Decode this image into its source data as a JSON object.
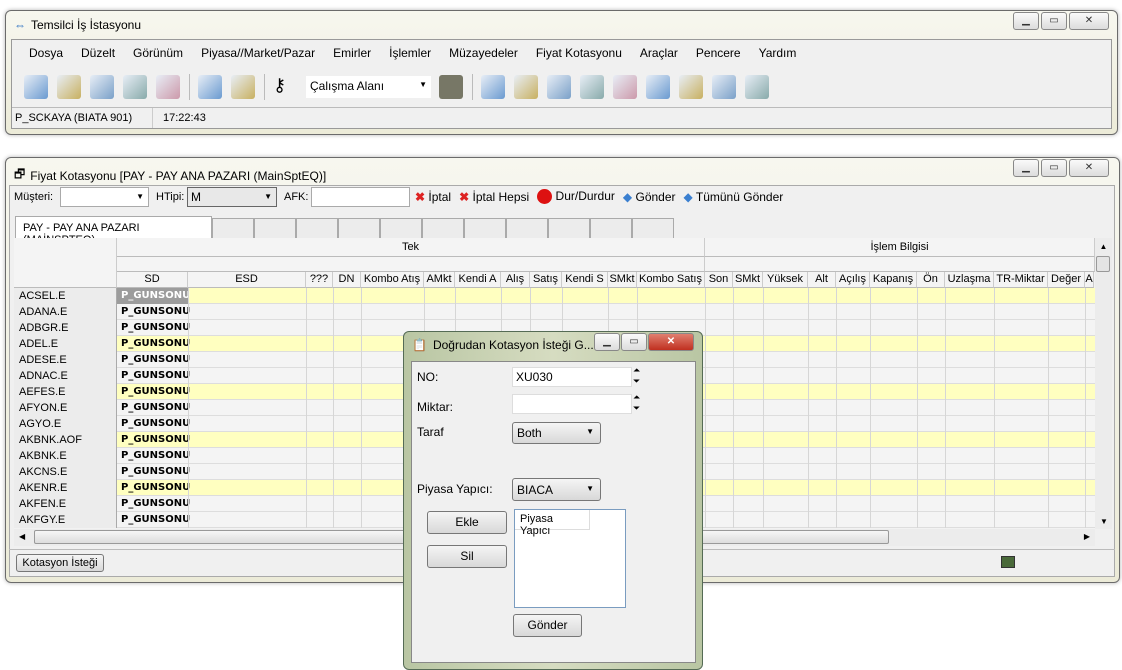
{
  "main_window": {
    "title": "Temsilci İş İstasyonu",
    "menu": [
      "Dosya",
      "Düzelt",
      "Görünüm",
      "Piyasa//Market/Pazar",
      "Emirler",
      "İşlemler",
      "Müzayedeler",
      "Fiyat Kotasyonu",
      "Araçlar",
      "Pencere",
      "Yardım"
    ],
    "toolbar_icons_a": [
      "search-icon",
      "info-icon",
      "download-icon",
      "document-arrow-icon",
      "new-window-icon"
    ],
    "toolbar_icons_b": [
      "add-window-icon",
      "layout-icon"
    ],
    "workspace_label": "Çalışma Alanı",
    "toolbar_icons_c": [
      "chat-icon",
      "heart-icon",
      "users-icon",
      "add-doc-icon",
      "star-doc-icon",
      "delete-doc-icon",
      "book-icon",
      "clock-icon",
      "doc-info-icon"
    ],
    "status_user": "P_SCKAYA (BIATA 901)",
    "status_time": "17:22:43"
  },
  "quote_window": {
    "title": "Fiyat Kotasyonu [PAY - PAY ANA PAZARI (MainSptEQ)]",
    "customer_label": "Müşteri:",
    "customer_value": "",
    "htipi_label": "HTipi:",
    "htipi_value": "M",
    "afk_label": "AFK:",
    "afk_value": "",
    "actions": {
      "cancel": "İptal",
      "cancel_all": "İptal Hepsi",
      "stop": "Dur/Durdur",
      "send": "Gönder",
      "send_all": "Tümünü Gönder"
    },
    "tab": "PAY - PAY ANA PAZARI (MAİNSPTEQ)",
    "group_headers": {
      "tek": "Tek",
      "islem": "İşlem Bilgisi"
    },
    "columns": [
      "SD",
      "ESD",
      "???",
      "DN",
      "Kombo Atış",
      "AMkt",
      "Kendi A",
      "Alış",
      "Satış",
      "Kendi S",
      "SMkt",
      "Kombo Satış",
      "Son",
      "SMkt",
      "Yüksek",
      "Alt",
      "Açılış",
      "Kapanış",
      "Ön",
      "Uzlaşma",
      "TR-Miktar",
      "Değer",
      "A"
    ],
    "rows": [
      [
        "ACSEL.E",
        "P_GUNSONU"
      ],
      [
        "ADANA.E",
        "P_GUNSONU"
      ],
      [
        "ADBGR.E",
        "P_GUNSONU"
      ],
      [
        "ADEL.E",
        "P_GUNSONU"
      ],
      [
        "ADESE.E",
        "P_GUNSONU"
      ],
      [
        "ADNAC.E",
        "P_GUNSONU"
      ],
      [
        "AEFES.E",
        "P_GUNSONU"
      ],
      [
        "AFYON.E",
        "P_GUNSONU"
      ],
      [
        "AGYO.E",
        "P_GUNSONU"
      ],
      [
        "AKBNK.AOF",
        "P_GUNSONU"
      ],
      [
        "AKBNK.E",
        "P_GUNSONU"
      ],
      [
        "AKCNS.E",
        "P_GUNSONU"
      ],
      [
        "AKENR.E",
        "P_GUNSONU"
      ],
      [
        "AKFEN.E",
        "P_GUNSONU"
      ],
      [
        "AKFGY.E",
        "P_GUNSONU"
      ]
    ],
    "quote_request_button": "Kotasyon İsteği",
    "highlight_color": "#ffffc0"
  },
  "dialog": {
    "title": "Doğrudan Kotasyon İsteği G...",
    "no_label": "NO:",
    "no_value": "XU030",
    "miktar_label": "Miktar:",
    "miktar_value": "",
    "taraf_label": "Taraf",
    "taraf_value": "Both",
    "py_label": "Piyasa Yapıcı:",
    "py_value": "BIACA",
    "add": "Ekle",
    "remove": "Sil",
    "list_header": "Piyasa Yapıcı",
    "send": "Gönder"
  }
}
